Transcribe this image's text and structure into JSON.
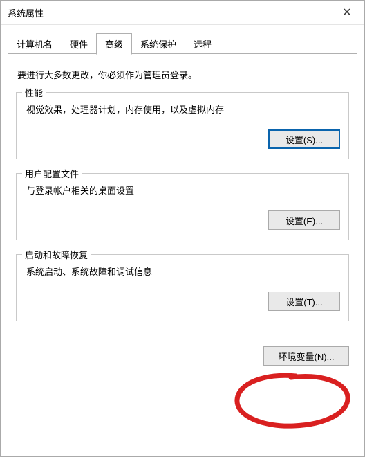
{
  "window": {
    "title": "系统属性",
    "close_glyph": "✕"
  },
  "tabs": {
    "items": [
      {
        "label": "计算机名"
      },
      {
        "label": "硬件"
      },
      {
        "label": "高级"
      },
      {
        "label": "系统保护"
      },
      {
        "label": "远程"
      }
    ],
    "active_index": 2
  },
  "intro": "要进行大多数更改，你必须作为管理员登录。",
  "groups": {
    "perf": {
      "legend": "性能",
      "desc": "视觉效果，处理器计划，内存使用，以及虚拟内存",
      "button": "设置(S)..."
    },
    "profile": {
      "legend": "用户配置文件",
      "desc": "与登录帐户相关的桌面设置",
      "button": "设置(E)..."
    },
    "startup": {
      "legend": "启动和故障恢复",
      "desc": "系统启动、系统故障和调试信息",
      "button": "设置(T)..."
    }
  },
  "env_button": "环境变量(N)..."
}
